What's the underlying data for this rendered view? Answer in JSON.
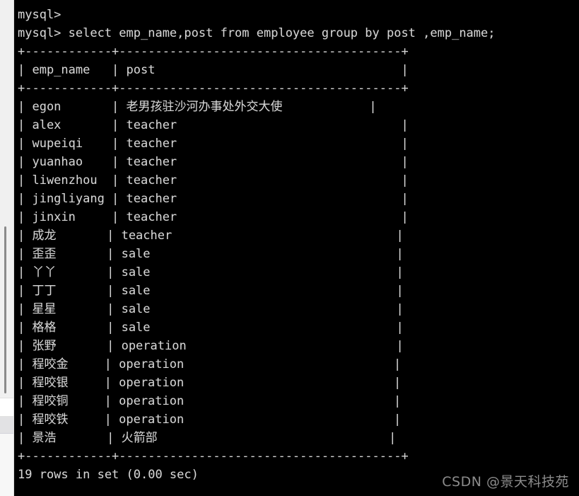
{
  "terminal": {
    "prompt_blank": "mysql>",
    "prompt_query": "mysql> select emp_name,post from employee group by post ,emp_name;",
    "status_line": "19 rows in set (0.00 sec)",
    "border_top": "+------------+---------------------------------------+",
    "border_mid": "+------------+---------------------------------------+",
    "border_bottom": "+------------+---------------------------------------+",
    "header_row": "| emp_name   | post                                  |",
    "rows": [
      "| egon       | 老男孩驻沙河办事处外交大使            |",
      "| alex       | teacher                               |",
      "| wupeiqi    | teacher                               |",
      "| yuanhao    | teacher                               |",
      "| liwenzhou  | teacher                               |",
      "| jingliyang | teacher                               |",
      "| jinxin     | teacher                               |",
      "| 成龙       | teacher                               |",
      "| 歪歪       | sale                                  |",
      "| 丫丫       | sale                                  |",
      "| 丁丁       | sale                                  |",
      "| 星星       | sale                                  |",
      "| 格格       | sale                                  |",
      "| 张野       | operation                             |",
      "| 程咬金     | operation                             |",
      "| 程咬银     | operation                             |",
      "| 程咬铜     | operation                             |",
      "| 程咬铁     | operation                             |",
      "| 景浩       | 火箭部                                |"
    ]
  },
  "table": {
    "columns": [
      "emp_name",
      "post"
    ],
    "records": [
      {
        "emp_name": "egon",
        "post": "老男孩驻沙河办事处外交大使"
      },
      {
        "emp_name": "alex",
        "post": "teacher"
      },
      {
        "emp_name": "wupeiqi",
        "post": "teacher"
      },
      {
        "emp_name": "yuanhao",
        "post": "teacher"
      },
      {
        "emp_name": "liwenzhou",
        "post": "teacher"
      },
      {
        "emp_name": "jingliyang",
        "post": "teacher"
      },
      {
        "emp_name": "jinxin",
        "post": "teacher"
      },
      {
        "emp_name": "成龙",
        "post": "teacher"
      },
      {
        "emp_name": "歪歪",
        "post": "sale"
      },
      {
        "emp_name": "丫丫",
        "post": "sale"
      },
      {
        "emp_name": "丁丁",
        "post": "sale"
      },
      {
        "emp_name": "星星",
        "post": "sale"
      },
      {
        "emp_name": "格格",
        "post": "sale"
      },
      {
        "emp_name": "张野",
        "post": "operation"
      },
      {
        "emp_name": "程咬金",
        "post": "operation"
      },
      {
        "emp_name": "程咬银",
        "post": "operation"
      },
      {
        "emp_name": "程咬铜",
        "post": "operation"
      },
      {
        "emp_name": "程咬铁",
        "post": "operation"
      },
      {
        "emp_name": "景浩",
        "post": "火箭部"
      }
    ],
    "row_count": 19
  },
  "watermark": {
    "text": "CSDN @景天科技苑"
  },
  "colors": {
    "terminal_background": "#000000",
    "terminal_text": "#d6d6d6",
    "gutter_background": "#f0f0f0",
    "scrollbar_thumb": "#8a8a8a",
    "watermark_text": "#8c8c8c"
  }
}
